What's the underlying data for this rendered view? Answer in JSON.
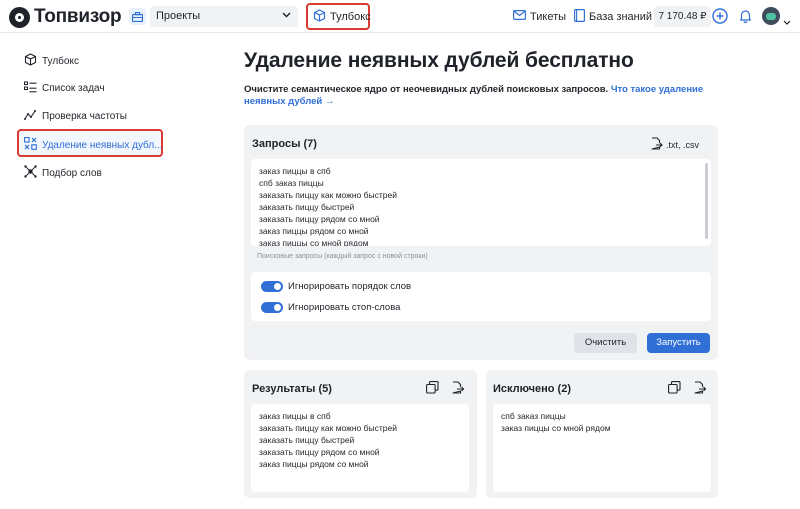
{
  "header": {
    "logo_text": "Топвизор",
    "project_select": "Проекты",
    "toolbox_label": "Тулбокс",
    "tickets_label": "Тикеты",
    "knowledge_label": "База знаний",
    "balance": "7 170.48 ₽"
  },
  "sidebar": {
    "items": [
      {
        "label": "Тулбокс",
        "icon": "cube-icon"
      },
      {
        "label": "Список задач",
        "icon": "task-list-icon"
      },
      {
        "label": "Проверка частоты",
        "icon": "frequency-graph-icon"
      },
      {
        "label": "Удаление неявных дубл...",
        "icon": "dedupe-icon",
        "active": true
      },
      {
        "label": "Подбор слов",
        "icon": "word-picker-icon"
      }
    ]
  },
  "main": {
    "title": "Удаление неявных дублей бесплатно",
    "subtitle_text": "Очистите семантическое ядро от неочевидных дублей поисковых запросов.",
    "subtitle_link": "Что такое удаление неявных дублей →",
    "queries": {
      "title": "Запросы (7)",
      "file_formats": ".txt, .csv",
      "lines": [
        "заказ пиццы в спб",
        "спб заказ пиццы",
        "заказать пиццу как можно быстрей",
        "заказать пиццу быстрей",
        "заказать пиццу рядом со мной",
        "заказ пиццы рядом со мной",
        "заказ пиццы со мной рядом"
      ],
      "hint": "Поисковые запросы (каждый запрос с новой строки)"
    },
    "options": {
      "ignore_order": "Игнорировать порядок слов",
      "ignore_stopwords": "Игнорировать стоп-слова"
    },
    "buttons": {
      "clear": "Очистить",
      "run": "Запустить"
    },
    "results": {
      "title": "Результаты (5)",
      "lines": [
        "заказ пиццы в спб",
        "заказать пиццу как можно быстрей",
        "заказать пиццу быстрей",
        "заказать пиццу рядом со мной",
        "заказ пиццы рядом со мной"
      ]
    },
    "excluded": {
      "title": "Исключено (2)",
      "lines": [
        "спб заказ пиццы",
        "заказ пиццы со мной рядом"
      ]
    }
  },
  "colors": {
    "accent": "#2f6fd6",
    "highlight_border": "#d63a31",
    "panel_bg": "#f1f2f4"
  }
}
